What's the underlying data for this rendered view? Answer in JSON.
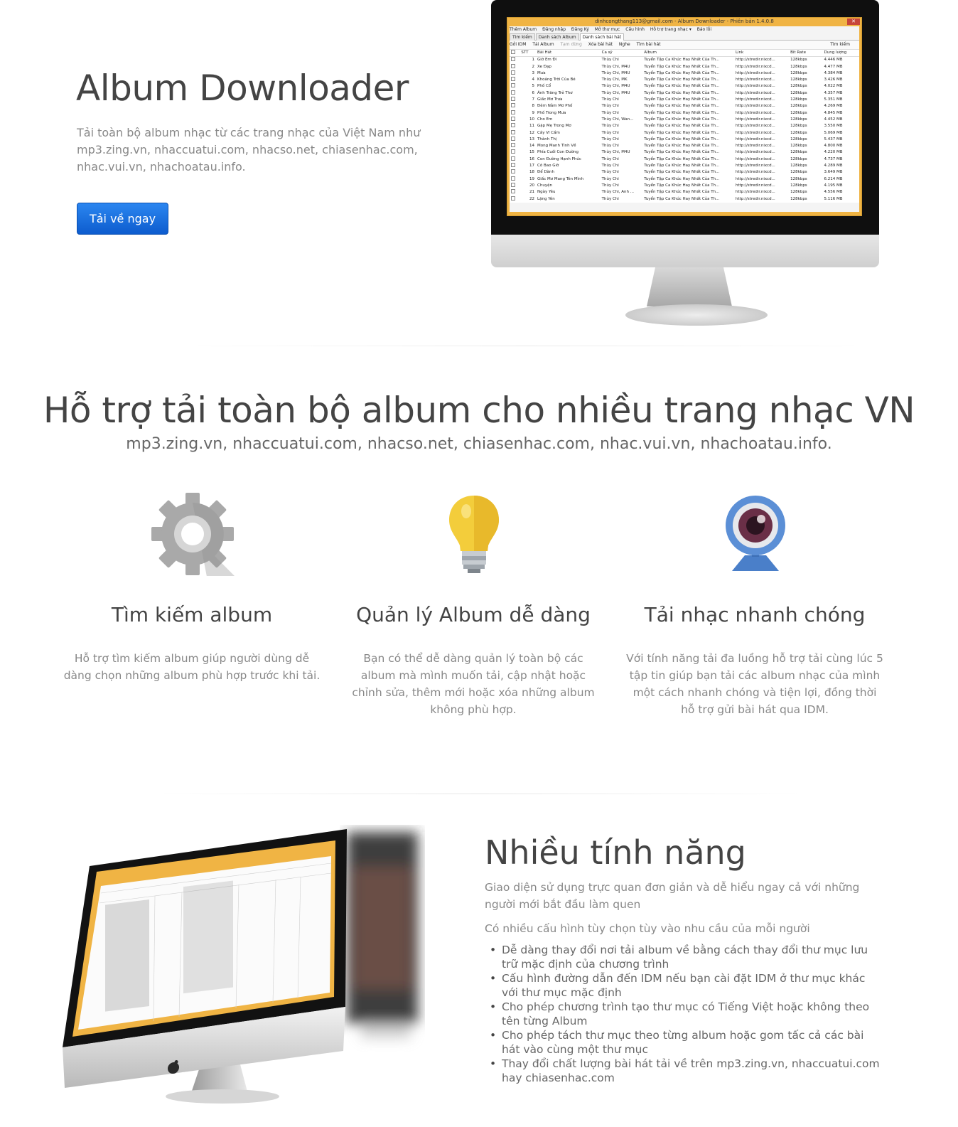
{
  "hero": {
    "title": "Album Downloader",
    "description": "Tải toàn bộ album nhạc từ các trang nhạc của Việt Nam như mp3.zing.vn, nhaccuatui.com, nhacso.net, chiasenhac.com, nhac.vui.vn, nhachoatau.info.",
    "download_button": "Tải về ngay"
  },
  "app_window": {
    "title": "dinhcongthang113@gmail.com - Album Downloader - Phiên bản 1.4.0.8",
    "close": "✕",
    "menu": [
      "Thêm Album",
      "Đăng nhập",
      "Đăng Ký",
      "Mở thư mục",
      "Cấu hình",
      "Hỗ trợ trang nhạc ▾",
      "Báo lỗi"
    ],
    "tabs": [
      "Tìm kiếm",
      "Danh sách Album",
      "Danh sách bài hát"
    ],
    "toolbar": [
      "Gởi IDM",
      "Tải Album",
      "Tạm dừng",
      "Xóa bài hát",
      "Nghe",
      "Tìm bài hát"
    ],
    "search_label": "Tìm kiếm",
    "columns": [
      "STT",
      "Bài Hát",
      "Ca sỹ",
      "Album",
      "Link",
      "Bit Rate",
      "Dung lượng"
    ],
    "rows": [
      [
        "1",
        "Giờ Em Đi",
        "Thùy Chi",
        "Tuyển Tập Ca Khúc Hay Nhất Của Th...",
        "http://stredir.nixcd...",
        "128kbps",
        "4.446 MB"
      ],
      [
        "2",
        "Xe Đạp",
        "Thùy Chi, M4U",
        "Tuyển Tập Ca Khúc Hay Nhất Của Th...",
        "http://stredir.nixcd...",
        "128kbps",
        "4.477 MB"
      ],
      [
        "3",
        "Mưa",
        "Thùy Chi, M4U",
        "Tuyển Tập Ca Khúc Hay Nhất Của Th...",
        "http://stredir.nixcd...",
        "128kbps",
        "4.384 MB"
      ],
      [
        "4",
        "Khoảng Trời Của Bé",
        "Thùy Chi, MK",
        "Tuyển Tập Ca Khúc Hay Nhất Của Th...",
        "http://stredir.nixcd...",
        "128kbps",
        "3.426 MB"
      ],
      [
        "5",
        "Phố Cổ",
        "Thùy Chi, M4U",
        "Tuyển Tập Ca Khúc Hay Nhất Của Th...",
        "http://stredir.nixcd...",
        "128kbps",
        "4.022 MB"
      ],
      [
        "6",
        "Ánh Trăng Trẻ Thơ",
        "Thùy Chi, M4U",
        "Tuyển Tập Ca Khúc Hay Nhất Của Th...",
        "http://stredir.nixcd...",
        "128kbps",
        "4.357 MB"
      ],
      [
        "7",
        "Giấc Mơ Trưa",
        "Thùy Chi",
        "Tuyển Tập Ca Khúc Hay Nhất Của Th...",
        "http://stredir.nixcd...",
        "128kbps",
        "5.351 MB"
      ],
      [
        "8",
        "Đêm Nằm Mơ Phố",
        "Thùy Chi",
        "Tuyển Tập Ca Khúc Hay Nhất Của Th...",
        "http://stredir.nixcd...",
        "128kbps",
        "4.269 MB"
      ],
      [
        "9",
        "Phố Trong Mưa",
        "Thùy Chi",
        "Tuyển Tập Ca Khúc Hay Nhất Của Th...",
        "http://stredir.nixcd...",
        "128kbps",
        "4.845 MB"
      ],
      [
        "10",
        "Cho Em",
        "Thùy Chi, Wan...",
        "Tuyển Tập Ca Khúc Hay Nhất Của Th...",
        "http://stredir.nixcd...",
        "128kbps",
        "4.452 MB"
      ],
      [
        "11",
        "Gặp Mẹ Trong Mơ",
        "Thùy Chi",
        "Tuyển Tập Ca Khúc Hay Nhất Của Th...",
        "http://stredir.nixcd...",
        "128kbps",
        "3.550 MB"
      ],
      [
        "12",
        "Cây Vĩ Cầm",
        "Thùy Chi",
        "Tuyển Tập Ca Khúc Hay Nhất Của Th...",
        "http://stredir.nixcd...",
        "128kbps",
        "5.069 MB"
      ],
      [
        "13",
        "Thành Thị",
        "Thùy Chi",
        "Tuyển Tập Ca Khúc Hay Nhất Của Th...",
        "http://stredir.nixcd...",
        "128kbps",
        "5.437 MB"
      ],
      [
        "14",
        "Mong Manh Tình Về",
        "Thùy Chi",
        "Tuyển Tập Ca Khúc Hay Nhất Của Th...",
        "http://stredir.nixcd...",
        "128kbps",
        "4.800 MB"
      ],
      [
        "15",
        "Phía Cuối Con Đường",
        "Thùy Chi, M4U",
        "Tuyển Tập Ca Khúc Hay Nhất Của Th...",
        "http://stredir.nixcd...",
        "128kbps",
        "4.220 MB"
      ],
      [
        "16",
        "Con Đường Hạnh Phúc",
        "Thùy Chi",
        "Tuyển Tập Ca Khúc Hay Nhất Của Th...",
        "http://stredir.nixcd...",
        "128kbps",
        "4.737 MB"
      ],
      [
        "17",
        "Cô Bao Giờ",
        "Thùy Chi",
        "Tuyển Tập Ca Khúc Hay Nhất Của Th...",
        "http://stredir.nixcd...",
        "128kbps",
        "4.289 MB"
      ],
      [
        "18",
        "Để Dành",
        "Thùy Chi",
        "Tuyển Tập Ca Khúc Hay Nhất Của Th...",
        "http://stredir.nixcd...",
        "128kbps",
        "3.649 MB"
      ],
      [
        "19",
        "Giấc Mơ Mang Tên Mình",
        "Thùy Chi",
        "Tuyển Tập Ca Khúc Hay Nhất Của Th...",
        "http://stredir.nixcd...",
        "128kbps",
        "6.214 MB"
      ],
      [
        "20",
        "Chuyện",
        "Thùy Chi",
        "Tuyển Tập Ca Khúc Hay Nhất Của Th...",
        "http://stredir.nixcd...",
        "128kbps",
        "4.195 MB"
      ],
      [
        "21",
        "Ngày Yêu",
        "Thùy Chi, Anh ...",
        "Tuyển Tập Ca Khúc Hay Nhất Của Th...",
        "http://stredir.nixcd...",
        "128kbps",
        "4.556 MB"
      ],
      [
        "22",
        "Lặng Yên",
        "Thùy Chi",
        "Tuyển Tập Ca Khúc Hay Nhất Của Th...",
        "http://stredir.nixcd...",
        "128kbps",
        "5.116 MB"
      ]
    ]
  },
  "section2": {
    "title": "Hỗ trợ tải toàn bộ album cho nhiều trang nhạc VN",
    "subtitle": "mp3.zing.vn, nhaccuatui.com, nhacso.net, chiasenhac.com, nhac.vui.vn, nhachoatau.info.",
    "features": [
      {
        "icon": "gear-icon",
        "title": "Tìm kiếm album",
        "text": "Hỗ trợ tìm kiếm album giúp người dùng dễ dàng chọn những album phù hợp trước khi tải."
      },
      {
        "icon": "lightbulb-icon",
        "title": "Quản lý Album dễ dàng",
        "text": "Bạn có thể dễ dàng quản lý toàn bộ các album mà mình muốn tải, cập nhật hoặc chỉnh sửa, thêm mới hoặc xóa những album không phù hợp."
      },
      {
        "icon": "webcam-icon",
        "title": "Tải nhạc nhanh chóng",
        "text": "Với tính năng tải đa luồng hỗ trợ tải cùng lúc 5 tập tin giúp bạn tải các album nhạc của mình một cách nhanh chóng và tiện lợi, đồng thời hỗ trợ gửi bài hát qua IDM."
      }
    ]
  },
  "section3": {
    "title": "Nhiều tính năng",
    "p1": "Giao diện sử dụng trực quan đơn giản và dễ hiểu ngay cả với những người mới bắt đầu làm quen",
    "p2": "Có nhiều cấu hình tùy chọn tùy vào nhu cầu của mỗi người",
    "list": [
      "Dễ dàng thay đổi nơi tải album về bằng cách thay đổi thư mục lưu trữ mặc định của chương trình",
      "Cấu hình đường dẫn đến IDM nếu bạn cài đặt IDM ở thư mục khác với thư mục mặc định",
      "Cho phép chương trình tạo thư mục có Tiếng Việt hoặc không theo tên từng Album",
      "Cho phép tách thư mục theo từng album hoặc gom tấc cả các bài hát vào cùng một thư mục",
      "Thay đổi chất lượng bài hát tải về trên mp3.zing.vn, nhaccuatui.com hay chiasenhac.com"
    ]
  },
  "colors": {
    "accent": "#0d5cce",
    "window_frame": "#f0b444",
    "heading": "#444444",
    "body_text": "#888888"
  }
}
